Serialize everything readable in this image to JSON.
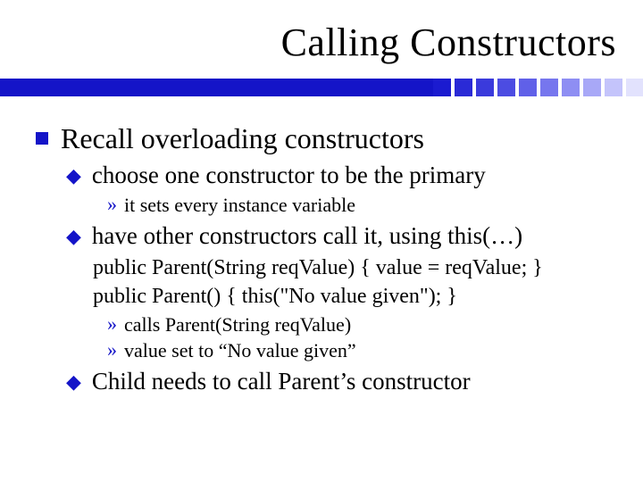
{
  "title": "Calling Constructors",
  "decor": {
    "colors": [
      "#1b1bd0",
      "#2a2ad6",
      "#3a3adc",
      "#4c4ce2",
      "#6060e8",
      "#7676ee",
      "#8e8ef3",
      "#a8a8f7",
      "#c4c4fb",
      "#e2e2fd"
    ]
  },
  "content": {
    "b1": "Recall overloading constructors",
    "s1": "choose one constructor to be the primary",
    "s1a": "it sets every instance variable",
    "s2": "have other constructors call it, using this(…)",
    "code1": "public Parent(String reqValue) { value = reqValue; }",
    "code2": "public Parent() { this(\"No value given\"); }",
    "c1": "calls Parent(String reqValue)",
    "c2": "value set to “No value given”",
    "s3": "Child needs to call Parent’s constructor"
  }
}
